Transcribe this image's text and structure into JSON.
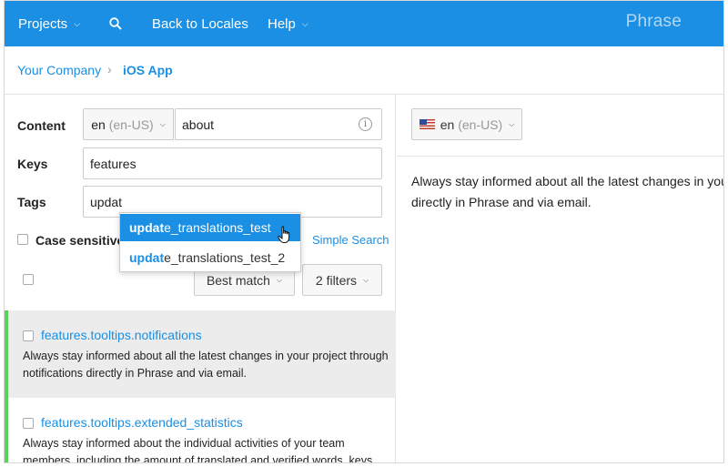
{
  "nav": {
    "projects": "Projects",
    "back": "Back to Locales",
    "help": "Help",
    "brand": "Phrase"
  },
  "breadcrumb": {
    "company": "Your Company",
    "separator": "›",
    "project": "iOS App"
  },
  "filters": {
    "content_label": "Content",
    "locale_code": "en",
    "locale_region": "(en-US)",
    "content_value": "about",
    "keys_label": "Keys",
    "keys_value": "features",
    "tags_label": "Tags",
    "tags_value": "updat",
    "case_sensitive": "Case sensitive",
    "simple_search": "Simple Search"
  },
  "autocomplete": {
    "items": [
      {
        "match": "updat",
        "rest": "e_translations_test"
      },
      {
        "match": "updat",
        "rest": "e_translations_test_2"
      }
    ]
  },
  "sort": {
    "best_match": "Best match",
    "filters": "2 filters"
  },
  "keys": [
    {
      "name": "features.tooltips.notifications",
      "line1": "Always stay informed about all the latest changes in your project through",
      "line2": "notifications directly in Phrase and via email."
    },
    {
      "name": "features.tooltips.extended_statistics",
      "line1": "Always stay informed about the individual activities of your team",
      "line2": "members, including the amount of translated and verified words, keys"
    }
  ],
  "editor": {
    "locale_code": "en",
    "locale_region": "(en-US)",
    "line1": "Always stay informed about all the latest changes in you",
    "line2": "directly in Phrase and via email."
  },
  "colors": {
    "accent": "#1a8fe3",
    "status_bar": "#5ad25a"
  }
}
